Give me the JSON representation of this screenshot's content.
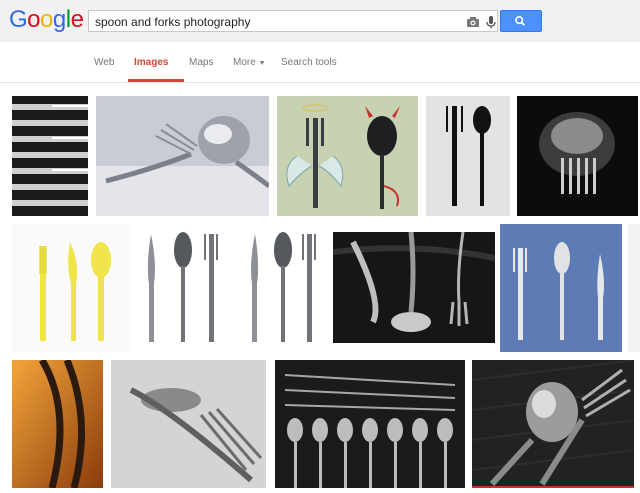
{
  "logo": {
    "letters": [
      "G",
      "o",
      "o",
      "g",
      "l",
      "e"
    ],
    "colors": [
      "#3369e8",
      "#d50f25",
      "#eeb211",
      "#3369e8",
      "#009925",
      "#d50f25"
    ]
  },
  "search": {
    "query": "spoon and forks photography",
    "placeholder": ""
  },
  "icons": {
    "camera": "camera-icon",
    "mic": "microphone-icon",
    "search": "search-icon"
  },
  "tabs": [
    {
      "label": "Web",
      "active": false
    },
    {
      "label": "Images",
      "active": true
    },
    {
      "label": "Maps",
      "active": false
    },
    {
      "label": "More",
      "active": false,
      "has_dropdown": true
    },
    {
      "label": "Search tools",
      "active": false
    }
  ],
  "colors": {
    "accent_red": "#d14836",
    "blue_button": "#4d90fe",
    "header_bg": "#f1f1f1"
  },
  "results": {
    "rows": 3,
    "images": [
      "forks-stacked-bw",
      "fork-and-spoon-closeup",
      "angel-fork-devil-spoon",
      "fork-spoon-silhouette",
      "fork-dome-dark",
      "yellow-plastic-cutlery",
      "knife-spoon-fork-white",
      "knife-spoon-fork-white-2",
      "cutlery-on-black-cloth",
      "cutlery-on-blue",
      "bent-spoon-orange",
      "fork-macro-gray",
      "rows-of-spoons-forks",
      "spoon-fork-dark-mat"
    ]
  }
}
